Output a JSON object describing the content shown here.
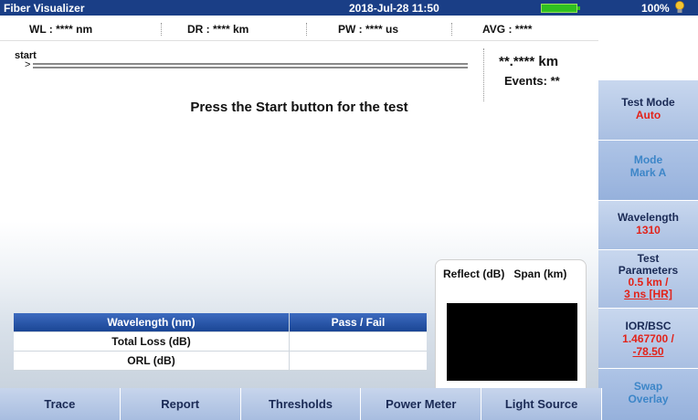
{
  "title_bar": {
    "app_name": "Fiber Visualizer",
    "datetime": "2018-Jul-28 11:50",
    "battery_percent": "100%",
    "battery_level": 1.0
  },
  "info": {
    "wl": "WL : **** nm",
    "dr": "DR : **** km",
    "pw": "PW : **** us",
    "avg": "AVG : ****"
  },
  "trace": {
    "start_label": "start",
    "start_arrow": ">",
    "distance": "**.**** km",
    "events": "Events: **",
    "message": "Press the Start button for the test"
  },
  "results_table": {
    "headers": [
      "Wavelength (nm)",
      "Pass / Fail"
    ],
    "rows": [
      [
        "Total Loss (dB)",
        ""
      ],
      [
        "ORL (dB)",
        ""
      ]
    ]
  },
  "reflect_panel": {
    "header": "Reflect (dB)   Span (km)"
  },
  "side_buttons": [
    {
      "label": "Test Mode",
      "value": "Auto"
    },
    {
      "label": "Mode",
      "value": "Mark A"
    },
    {
      "label": "Wavelength",
      "value": "1310"
    },
    {
      "label": "Test",
      "label2": "Parameters",
      "value": "0.5 km /",
      "value2": "3 ns [HR]"
    },
    {
      "label": "IOR/BSC",
      "value": "1.467700 /",
      "value2": "-78.50"
    },
    {
      "label": "Swap",
      "label2": "Overlay"
    }
  ],
  "tabs": [
    "Trace",
    "Report",
    "Thresholds",
    "Power Meter",
    "Light Source"
  ],
  "colors": {
    "title_bar": "#1a3e86",
    "accent_red": "#e2231a",
    "battery_green": "#30c020"
  }
}
